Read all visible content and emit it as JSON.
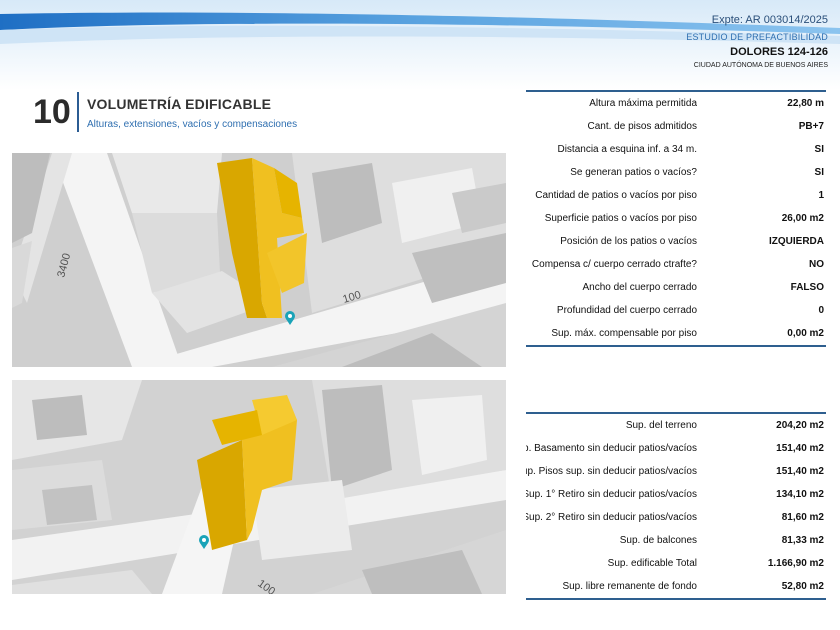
{
  "header": {
    "expte": "Expte: AR 003014/2025",
    "estudio": "ESTUDIO DE PREFACTIBILIDAD",
    "address": "DOLORES 124-126",
    "city": "CIUDAD AUTÓNOMA DE BUENOS AIRES"
  },
  "section": {
    "number": "10",
    "title": "VOLUMETRÍA EDIFICABLE",
    "subtitle": "Alturas, extensiones, vacíos y compensaciones"
  },
  "maps": {
    "map1_labels": [
      "3400",
      "100"
    ],
    "map2_labels": [
      "100"
    ]
  },
  "colors": {
    "accent_blue": "#2e5f8f",
    "building_yellow": "#e6b400",
    "marker": "#1aa3b8"
  },
  "table1": [
    {
      "label": "Altura máxima permitida",
      "value": "22,80 m"
    },
    {
      "label": "Cant. de pisos admitidos",
      "value": "PB+7"
    },
    {
      "label": "Distancia a esquina inf. a 34 m.",
      "value": "SI"
    },
    {
      "label": "Se generan patios o vacíos?",
      "value": "SI"
    },
    {
      "label": "Cantidad de patios o vacíos por piso",
      "value": "1"
    },
    {
      "label": "Superficie patios o vacíos por piso",
      "value": "26,00 m2"
    },
    {
      "label": "Posición de los patios o vacíos",
      "value": "IZQUIERDA"
    },
    {
      "label": "Compensa c/ cuerpo cerrado ctrafte?",
      "value": "NO"
    },
    {
      "label": "Ancho del  cuerpo cerrado",
      "value": "FALSO"
    },
    {
      "label": "Profundidad del  cuerpo cerrado",
      "value": "0"
    },
    {
      "label": "Sup. máx. compensable por piso",
      "value": "0,00 m2"
    }
  ],
  "table2": [
    {
      "label": "Sup. del terreno",
      "value": "204,20 m2"
    },
    {
      "label": "Sup. Basamento sin deducir patios/vacíos",
      "value": "151,40 m2"
    },
    {
      "label": "Sup. Pisos sup. sin deducir patios/vacíos",
      "value": "151,40 m2"
    },
    {
      "label": "Sup. 1° Retiro sin deducir patios/vacíos",
      "value": "134,10 m2"
    },
    {
      "label": "Sup. 2° Retiro sin deducir patios/vacíos",
      "value": "81,60 m2"
    },
    {
      "label": "Sup. de balcones",
      "value": "81,33 m2"
    },
    {
      "label": "Sup. edificable Total",
      "value": "1.166,90 m2"
    },
    {
      "label": "Sup. libre remanente de fondo",
      "value": "52,80 m2"
    }
  ]
}
